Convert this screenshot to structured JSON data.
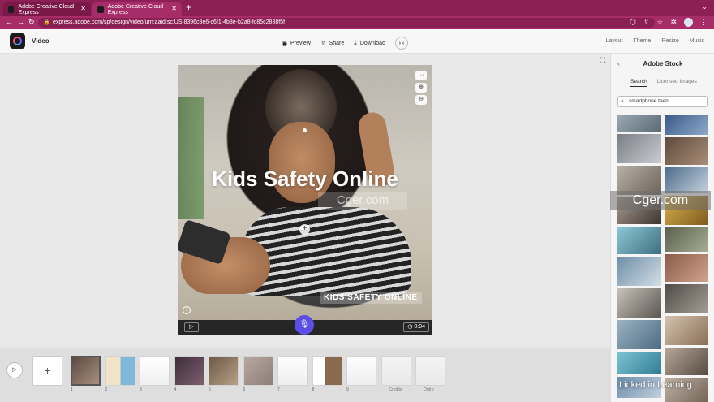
{
  "browser": {
    "tabs": [
      {
        "label": "Adobe Creative Cloud Express",
        "active": false
      },
      {
        "label": "Adobe Creative Cloud Express",
        "active": true
      }
    ],
    "url": "express.adobe.com/sp/design/video/urn:aaid:sc:US:8396c8e6-c6f1-4b8e-b2a8-fc85c2888f5f"
  },
  "header": {
    "title": "Video",
    "actions": {
      "preview": "Preview",
      "share": "Share",
      "download": "Download"
    },
    "right_menu": {
      "layout": "Layout",
      "theme": "Theme",
      "resize": "Resize",
      "music": "Music"
    }
  },
  "slide": {
    "title": "Kids Safety Online",
    "subtitle": "KIDS SAFETY ONLINE",
    "duration": "0:04",
    "more_label": "···"
  },
  "panel": {
    "title": "Adobe Stock",
    "tabs": {
      "search": "Search",
      "licensed": "Licensed Images"
    },
    "search_value": "smartphone teen"
  },
  "timeline": {
    "scenes": [
      {
        "num": "1",
        "label": ""
      },
      {
        "num": "2",
        "label": ""
      },
      {
        "num": "3",
        "label": ""
      },
      {
        "num": "4",
        "label": ""
      },
      {
        "num": "5",
        "label": ""
      },
      {
        "num": "6",
        "label": ""
      },
      {
        "num": "7",
        "label": ""
      },
      {
        "num": "8",
        "label": ""
      },
      {
        "num": "9",
        "label": ""
      },
      {
        "num": "",
        "label": "Credits"
      },
      {
        "num": "",
        "label": "Outro"
      }
    ]
  },
  "watermarks": {
    "cger_center": "Cger.com",
    "cger_right": "Cger.com",
    "linkedin": "Linked in Learning"
  },
  "colors": {
    "tabbar": "#8e1f55",
    "addrbar": "#a72d68",
    "mic": "#5c4ee5"
  }
}
